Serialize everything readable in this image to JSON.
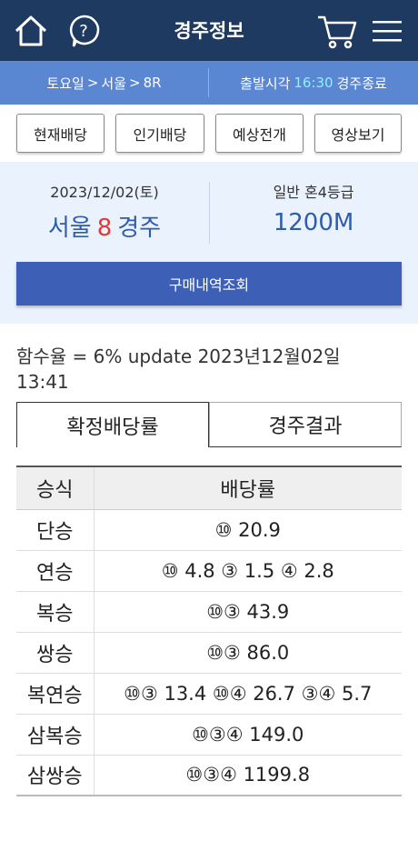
{
  "header": {
    "title": "경주정보",
    "icons": [
      "home-icon",
      "help-icon",
      "cart-icon",
      "menu-icon"
    ]
  },
  "crumb": {
    "day": "토요일",
    "place": "서울",
    "race": "8R",
    "start_label": "출발시각",
    "start_time": "16:30",
    "status": "경주종료"
  },
  "buttons": {
    "current_odds": "현재배당",
    "popular_odds": "인기배당",
    "prediction": "예상전개",
    "video": "영상보기",
    "purchase_history": "구매내역조회"
  },
  "info": {
    "date": "2023/12/02(토)",
    "place": "서울",
    "race_no": "8",
    "race_word": "경주",
    "grade": "일반 혼4등급",
    "distance": "1200M"
  },
  "rate_text": "함수율 = 6% update 2023년12월02일 13:41",
  "tabs": {
    "confirmed": "확정배당률",
    "result": "경주결과"
  },
  "table": {
    "headers": [
      "승식",
      "배당률"
    ],
    "rows": [
      {
        "type": "단승",
        "odds": "⑩ 20.9"
      },
      {
        "type": "연승",
        "odds": "⑩ 4.8 ③ 1.5 ④ 2.8"
      },
      {
        "type": "복승",
        "odds": "⑩③ 43.9"
      },
      {
        "type": "쌍승",
        "odds": "⑩③ 86.0"
      },
      {
        "type": "복연승",
        "odds": "⑩③ 13.4 ⑩④ 26.7 ③④ 5.7"
      },
      {
        "type": "삼복승",
        "odds": "⑩③④ 149.0"
      },
      {
        "type": "삼쌍승",
        "odds": "⑩③④ 1199.8"
      }
    ]
  },
  "colors": {
    "topbar": "#1f3a60",
    "crumbbar": "#5a86d2",
    "accent_time": "#8ff0ff",
    "race_blue": "#2f5cab",
    "race_red": "#e53935",
    "button_blue": "#3d5fb5"
  }
}
